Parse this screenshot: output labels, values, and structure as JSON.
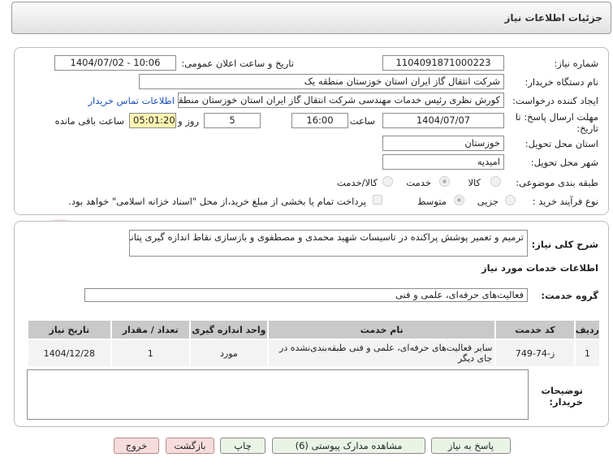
{
  "header": {
    "title": "جزئیات اطلاعات نیاز"
  },
  "form": {
    "need_number_label": "شماره نیاز:",
    "need_number": "1104091871000223",
    "announce_label": "تاریخ و ساعت اعلان عمومی:",
    "announce_value": "1404/07/02 - 10:06",
    "buyer_label": "نام دستگاه خریدار:",
    "buyer_value": "شرکت انتقال گاز ایران  استان خوزستان منطقه یک",
    "creator_label": "ایجاد کننده درخواست:",
    "creator_value": "کورش نظری رئیس خدمات مهندسی شرکت انتقال گاز ایران  استان خوزستان منطقه یک",
    "contact_link": "اطلاعات تماس خریدار",
    "deadline_label_1": "مهلت ارسال پاسخ: تا",
    "deadline_label_2": "تاریخ:",
    "deadline_date": "1404/07/07",
    "time_label": "ساعت",
    "deadline_time": "16:00",
    "days_value": "5",
    "days_label": "روز و",
    "remaining_time": "05:01:20",
    "remaining_label": "ساعت باقی مانده",
    "province_label": "استان محل تحویل:",
    "province_value": "خوزستان",
    "city_label": "شهر محل تحویل:",
    "city_value": "امیدیه",
    "category_label": "طبقه بندی موضوعی:",
    "category_options": [
      "کالا",
      "خدمت",
      "کالا/خدمت"
    ],
    "category_selected": "خدمت",
    "process_label": "نوع فرآیند خرید :",
    "process_options": [
      "جزیی",
      "متوسط"
    ],
    "process_selected": "متوسط",
    "payment_note": "پرداخت تمام یا بخشی از مبلغ خرید،از محل \"اسناد خزانه اسلامی\" خواهد بود."
  },
  "details": {
    "description_label": "شرح کلی نیاز:",
    "description_value": "ترمیم و تعمیر پوشش پراکنده در تاسیسات شهید محمدی و مصطفوی و بازسازی نقاط اندازه گیری پتانسیل",
    "services_heading": "اطلاعات خدمات مورد نیاز",
    "service_group_label": "گروه خدمت:",
    "service_group_value": "فعالیت‌های حرفه‌ای، علمی و فنی",
    "table": {
      "headers": [
        "ردیف",
        "کد خدمت",
        "نام خدمت",
        "واحد اندازه گیری",
        "تعداد / مقدار",
        "تاریخ نیاز"
      ],
      "rows": [
        [
          "1",
          "ز-74-749",
          "سایر فعالیت‌های حرفه‌ای، علمی و فنی طبقه‌بندی‌نشده در جای دیگر",
          "مورد",
          "1",
          "1404/12/28"
        ]
      ]
    },
    "buyer_notes_label_1": "توضیحات",
    "buyer_notes_label_2": "خریدار:",
    "buyer_notes_value": ""
  },
  "buttons": {
    "reply": "پاسخ به نیاز",
    "view_docs": "مشاهده مدارک پیوستی (6)",
    "print": "چاپ",
    "back": "بازگشت",
    "exit": "خروج"
  },
  "colors": {
    "remaining_time_bg": "#fdf5b2",
    "link": "#1a4fb7",
    "button_green": "#e9f4e7",
    "button_red": "#f6dcdc"
  }
}
